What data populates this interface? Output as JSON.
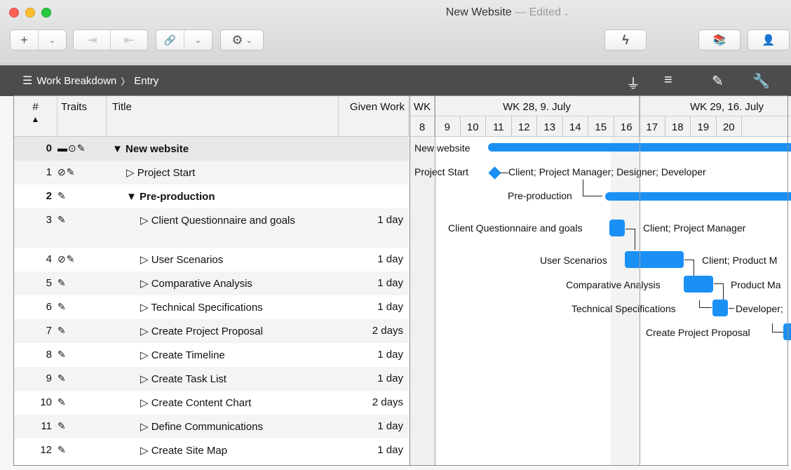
{
  "window": {
    "title": "New Website",
    "separator": " — ",
    "status": "Edited"
  },
  "colors": {
    "accent": "#1a90f5",
    "close": "#fe5f57",
    "minimize": "#febc2e",
    "zoom": "#28c840"
  },
  "toolbar": {
    "add": "+",
    "chevron": "⌄",
    "indent": "⇥",
    "outdent": "⇤",
    "link": "🔗",
    "gear": "⚙",
    "lightning": "ϟ",
    "library": "📚",
    "user": "👤"
  },
  "icons": [
    "filter-icon",
    "gantt-icon",
    "brush-icon",
    "wrench-icon",
    "work-breakdown-icon"
  ],
  "breadcrumb": {
    "root": "Work Breakdown",
    "sep": "〉",
    "child": "Entry"
  },
  "columns": {
    "num": "#",
    "traits": "Traits",
    "title": "Title",
    "work": "Given Work"
  },
  "rows": [
    {
      "num": "0",
      "traits": "▬⊙✎",
      "title": "▼ New website",
      "work": ""
    },
    {
      "num": "1",
      "traits": "⊘✎",
      "title": "▷ Project Start",
      "work": ""
    },
    {
      "num": "2",
      "traits": "✎",
      "title": "▼ Pre-production",
      "work": ""
    },
    {
      "num": "3",
      "traits": "✎",
      "title": "▷ Client Questionnaire and goals",
      "work": "1 day"
    },
    {
      "num": "4",
      "traits": "⊘✎",
      "title": "▷ User Scenarios",
      "work": "1 day"
    },
    {
      "num": "5",
      "traits": "✎",
      "title": "▷ Comparative Analysis",
      "work": "1 day"
    },
    {
      "num": "6",
      "traits": "✎",
      "title": "▷ Technical Specifications",
      "work": "1 day"
    },
    {
      "num": "7",
      "traits": "✎",
      "title": "▷ Create Project Proposal",
      "work": "2 days"
    },
    {
      "num": "8",
      "traits": "✎",
      "title": "▷ Create Timeline",
      "work": "1 day"
    },
    {
      "num": "9",
      "traits": "✎",
      "title": "▷ Create Task List",
      "work": "1 day"
    },
    {
      "num": "10",
      "traits": "✎",
      "title": "▷ Create Content Chart",
      "work": "2 days"
    },
    {
      "num": "11",
      "traits": "✎",
      "title": "▷ Define Communications",
      "work": "1 day"
    },
    {
      "num": "12",
      "traits": "✎",
      "title": "▷ Create Site Map",
      "work": "1 day"
    }
  ],
  "gantt": {
    "weeks": [
      "WK",
      "WK 28, 9. July",
      "WK 29, 16. July"
    ],
    "days": [
      "8",
      "9",
      "10",
      "11",
      "12",
      "13",
      "14",
      "15",
      "16",
      "17",
      "18",
      "19",
      "20"
    ],
    "labels": {
      "new_website": "New website",
      "project_start": "Project Start",
      "project_start_res": "Client; Project Manager; Designer; Developer",
      "preproduction": "Pre-production",
      "cq": "Client Questionnaire and goals",
      "cq_res": "Client; Project Manager",
      "us": "User Scenarios",
      "us_res": "Client; Product M",
      "ca": "Comparative Analysis",
      "ca_res": "Product Ma",
      "ts": "Technical Specifications",
      "ts_res": "Developer;",
      "cpp": "Create Project Proposal"
    }
  }
}
